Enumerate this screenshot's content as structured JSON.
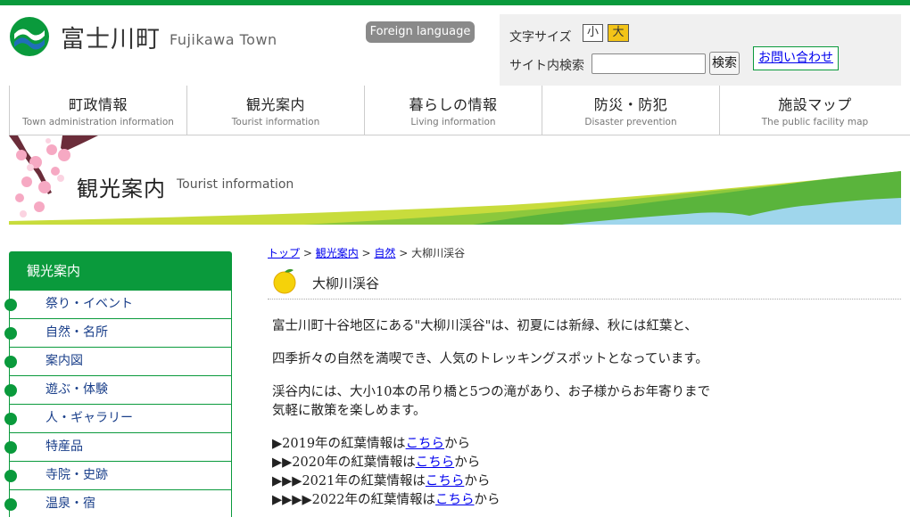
{
  "header": {
    "logo_jp": "富士川町",
    "logo_en": "Fujikawa Town",
    "foreign_language": "Foreign language",
    "font_size_label": "文字サイズ",
    "font_small": "小",
    "font_large": "大",
    "search_label": "サイト内検索",
    "search_value": "",
    "search_button": "検索",
    "contact": "お問い合わせ"
  },
  "gnav": [
    {
      "jp": "町政情報",
      "en": "Town administration information"
    },
    {
      "jp": "観光案内",
      "en": "Tourist information"
    },
    {
      "jp": "暮らしの情報",
      "en": "Living information"
    },
    {
      "jp": "防災・防犯",
      "en": "Disaster prevention"
    },
    {
      "jp": "施設マップ",
      "en": "The public facility map"
    }
  ],
  "banner": {
    "title": "観光案内",
    "subtitle": "Tourist information"
  },
  "sidenav": {
    "title": "観光案内",
    "items": [
      "祭り・イベント",
      "自然・名所",
      "案内図",
      "遊ぶ・体験",
      "人・ギャラリー",
      "特産品",
      "寺院・史跡",
      "温泉・宿"
    ]
  },
  "breadcrumb": {
    "top": "トップ",
    "tourism": "観光案内",
    "nature": "自然",
    "sep": " > ",
    "current": "大柳川渓谷"
  },
  "page": {
    "title": "大柳川渓谷",
    "p1": "富士川町十谷地区にある\"大柳川渓谷\"は、初夏には新緑、秋には紅葉と、",
    "p2": "四季折々の自然を満喫でき、人気のトレッキングスポットとなっています。",
    "p3a": "渓谷内には、大小10本の吊り橋と5つの滝があり、お子様からお年寄りまで",
    "p3b": "気軽に散策を楽しめます。",
    "info": [
      {
        "prefix": "▶2019年の紅葉情報は",
        "link": "こちら",
        "suffix": "から"
      },
      {
        "prefix": "▶▶2020年の紅葉情報は",
        "link": "こちら",
        "suffix": "から"
      },
      {
        "prefix": "▶▶▶2021年の紅葉情報は",
        "link": "こちら",
        "suffix": "から"
      },
      {
        "prefix": "▶▶▶▶2022年の紅葉情報は",
        "link": "こちら",
        "suffix": "から"
      }
    ]
  },
  "colors": {
    "brand_green": "#0a9a3c",
    "font_large_active": "#f3c418",
    "link": "#0000ee"
  }
}
